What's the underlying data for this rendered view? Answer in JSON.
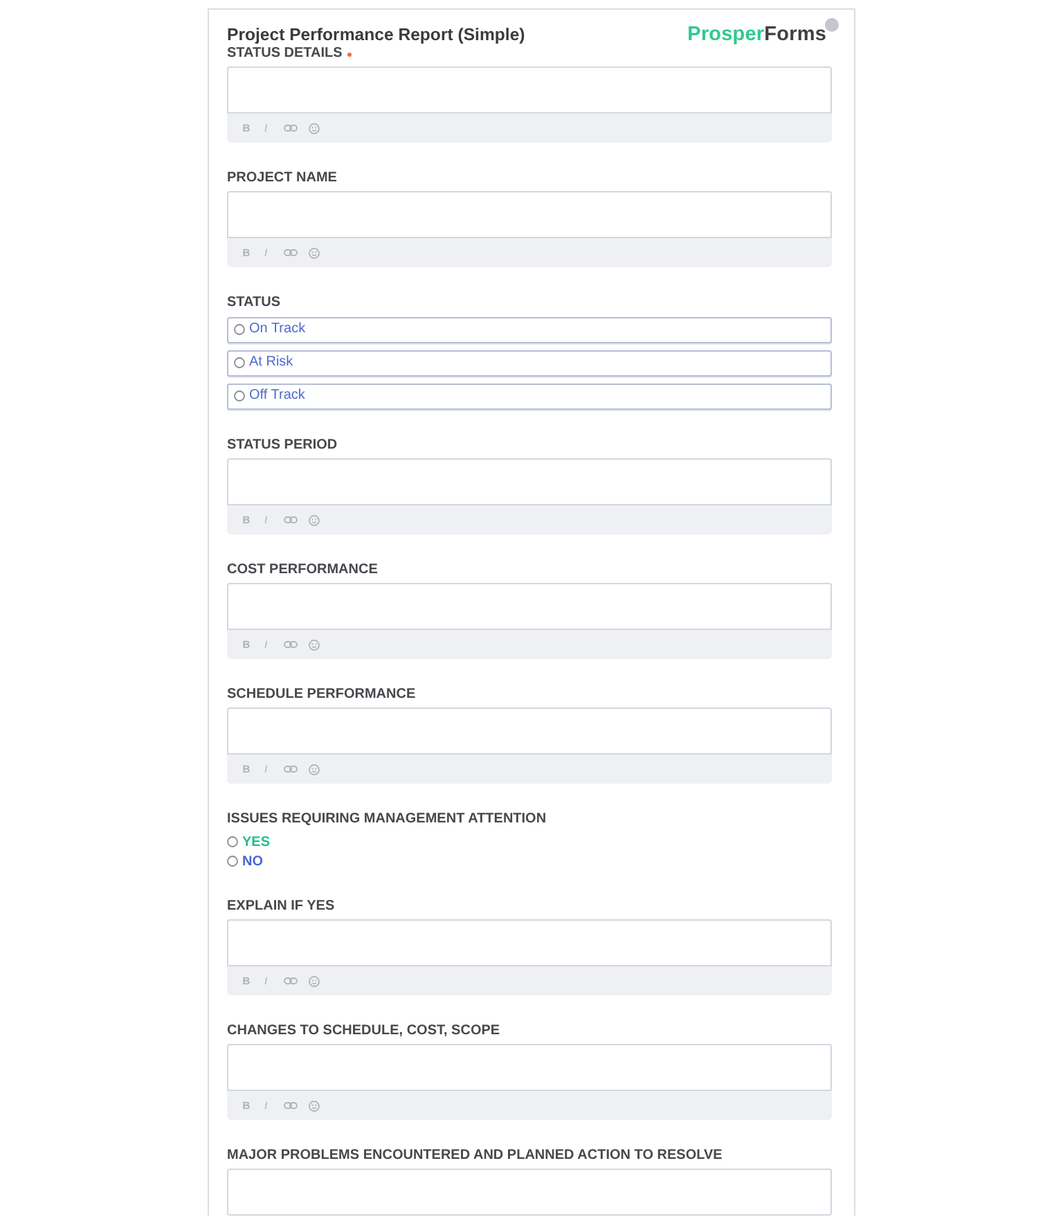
{
  "form": {
    "title": "Project Performance Report (Simple)",
    "logo": {
      "first": "Prosper",
      "second": "Forms"
    }
  },
  "fields": [
    {
      "kind": "rich_text",
      "label": "STATUS DETAILS",
      "required": true,
      "toolbar": {
        "bold": "B",
        "italic": "I"
      }
    },
    {
      "kind": "rich_text",
      "label": "PROJECT NAME",
      "required": false,
      "toolbar": {
        "bold": "B",
        "italic": "I"
      }
    },
    {
      "kind": "radio_boxed",
      "label": "STATUS",
      "required": false,
      "options": [
        {
          "label": "On Track",
          "selected": false
        },
        {
          "label": "At Risk",
          "selected": false
        },
        {
          "label": "Off Track",
          "selected": false
        }
      ]
    },
    {
      "kind": "rich_text",
      "label": "STATUS PERIOD",
      "required": false,
      "toolbar": {
        "bold": "B",
        "italic": "I"
      }
    },
    {
      "kind": "rich_text",
      "label": "COST PERFORMANCE",
      "required": false,
      "toolbar": {
        "bold": "B",
        "italic": "I"
      }
    },
    {
      "kind": "rich_text",
      "label": "SCHEDULE PERFORMANCE",
      "required": false,
      "toolbar": {
        "bold": "B",
        "italic": "I"
      }
    },
    {
      "kind": "radio_inline",
      "label": "ISSUES REQUIRING MANAGEMENT ATTENTION",
      "required": false,
      "options": [
        {
          "label": "YES",
          "selected": false,
          "color": "#25c08a"
        },
        {
          "label": "NO",
          "selected": false,
          "color": "#4a66d4"
        }
      ]
    },
    {
      "kind": "rich_text",
      "label": "EXPLAIN IF YES",
      "required": false,
      "toolbar": {
        "bold": "B",
        "italic": "I"
      }
    },
    {
      "kind": "rich_text",
      "label": "CHANGES TO SCHEDULE, COST, SCOPE",
      "required": false,
      "toolbar": {
        "bold": "B",
        "italic": "I"
      }
    },
    {
      "kind": "rich_text",
      "label": "MAJOR PROBLEMS ENCOUNTERED AND PLANNED ACTION TO RESOLVE",
      "required": false
    }
  ]
}
